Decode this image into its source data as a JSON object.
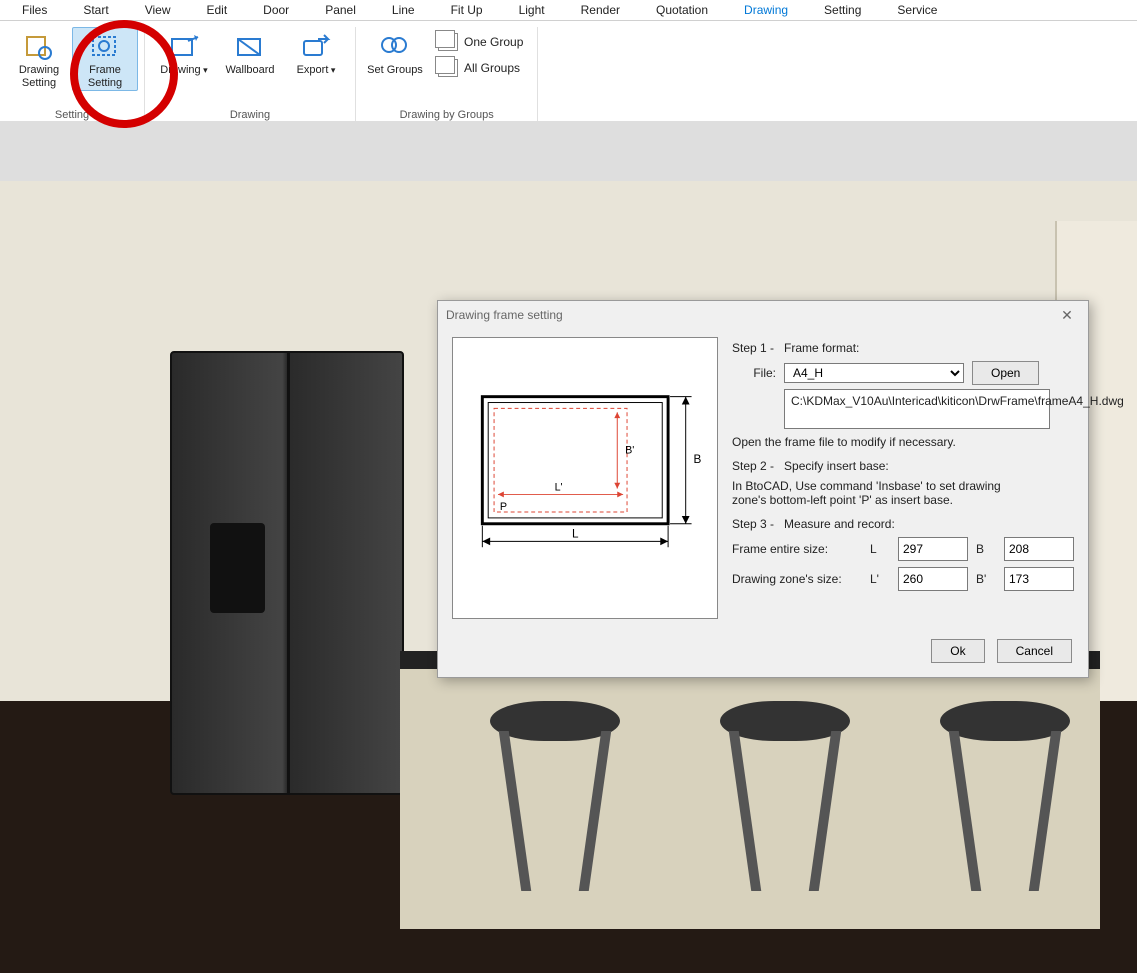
{
  "menu": {
    "items": [
      "Files",
      "Start",
      "View",
      "Edit",
      "Door",
      "Panel",
      "Line",
      "Fit Up",
      "Light",
      "Render",
      "Quotation",
      "Drawing",
      "Setting",
      "Service"
    ],
    "active": "Drawing"
  },
  "ribbon": {
    "groups": [
      {
        "label": "Setting",
        "buttons": [
          {
            "id": "drawing-setting",
            "cap": "Drawing\nSetting"
          },
          {
            "id": "frame-setting",
            "cap": "Frame\nSetting",
            "selected": true
          }
        ]
      },
      {
        "label": "Drawing",
        "buttons": [
          {
            "id": "drawing",
            "cap": "Drawing",
            "dd": true
          },
          {
            "id": "wallboard",
            "cap": "Wallboard"
          },
          {
            "id": "export",
            "cap": "Export",
            "dd": true
          }
        ]
      },
      {
        "label": "Drawing by Groups",
        "buttons": [
          {
            "id": "set-groups",
            "cap": "Set Groups"
          }
        ],
        "side": [
          {
            "id": "one-group",
            "cap": "One Group"
          },
          {
            "id": "all-groups",
            "cap": "All Groups"
          }
        ]
      }
    ]
  },
  "dialog": {
    "title": "Drawing frame setting",
    "step1": "Step 1 -",
    "step1t": "Frame format:",
    "fileLabel": "File:",
    "fileValue": "A4_H",
    "openLabel": "Open",
    "path": "C:\\KDMax_V10Au\\Intericad\\kiticon\\DrwFrame\\frameA4_H.dwg",
    "openNote": "Open the frame file to modify if necessary.",
    "step2": "Step 2 -",
    "step2t": "Specify insert base:",
    "step2note": "In BtoCAD, Use command 'Insbase' to set drawing zone's bottom-left point 'P' as insert base.",
    "step3": "Step 3 -",
    "step3t": "Measure and record:",
    "frameEntire": "Frame entire size:",
    "drawingZone": "Drawing zone's size:",
    "L": "L",
    "B": "B",
    "Lp": "L'",
    "Bp": "B'",
    "valL": "297",
    "valB": "208",
    "valLp": "260",
    "valBp": "173",
    "ok": "Ok",
    "cancel": "Cancel"
  },
  "diagram": {
    "L": "L",
    "B": "B",
    "Lp": "L'",
    "Bp": "B'",
    "P": "P"
  }
}
